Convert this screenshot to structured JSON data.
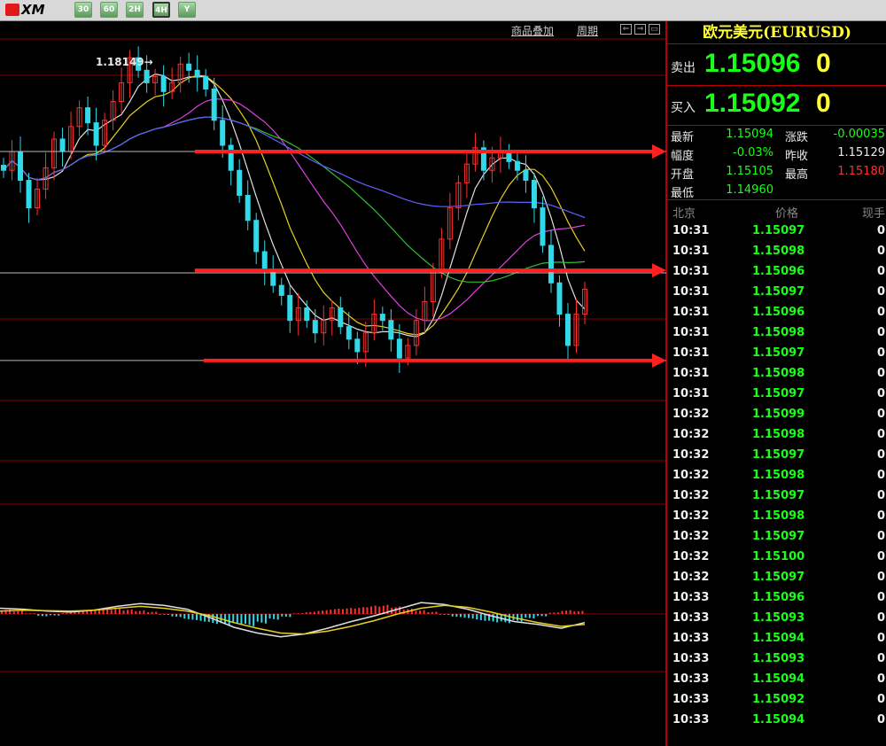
{
  "toolbar": {
    "logo_text": "XM",
    "buttons": [
      {
        "label": "30",
        "icon": "30-min-period"
      },
      {
        "label": "60",
        "icon": "60-min-period"
      },
      {
        "label": "2H",
        "icon": "2-hour-period"
      },
      {
        "label": "4H",
        "icon": "4-hour-period",
        "active": true
      },
      {
        "label": "Y",
        "icon": "filter-icon"
      }
    ]
  },
  "chart_header": {
    "add_product": "商品叠加",
    "period": "周期"
  },
  "chart_data": {
    "type": "candlestick",
    "symbol": "EURUSD",
    "timeframe": "4H",
    "annotation_high": "1.18149→",
    "price_range": [
      1.1485,
      1.1825
    ],
    "horizontal_levels_drawn": [
      1.1735,
      1.1638,
      1.1568
    ],
    "drawn_arrow_levels": [
      1.1735,
      1.164,
      1.1568
    ],
    "closes": [
      1.172,
      1.1735,
      1.1712,
      1.169,
      1.1705,
      1.1722,
      1.1745,
      1.1735,
      1.1755,
      1.177,
      1.1758,
      1.174,
      1.176,
      1.1775,
      1.179,
      1.181,
      1.18,
      1.179,
      1.1795,
      1.1783,
      1.179,
      1.1805,
      1.18,
      1.1795,
      1.1785,
      1.176,
      1.174,
      1.172,
      1.17,
      1.168,
      1.1655,
      1.164,
      1.1628,
      1.162,
      1.16,
      1.161,
      1.16,
      1.159,
      1.16,
      1.161,
      1.1595,
      1.1585,
      1.1575,
      1.159,
      1.1605,
      1.16,
      1.1585,
      1.157,
      1.158,
      1.16,
      1.1615,
      1.164,
      1.1665,
      1.169,
      1.171,
      1.1725,
      1.1738,
      1.172,
      1.173,
      1.1735,
      1.1727,
      1.172,
      1.1712,
      1.169,
      1.166,
      1.163,
      1.1605,
      1.158,
      1.1605,
      1.1625
    ],
    "macd_hist": [
      0.0012,
      0.0008,
      0.0002,
      -0.0006,
      -0.0004,
      0.0003,
      0.0009,
      0.0011,
      0.0012,
      0.0014,
      0.0012,
      0.0009,
      0.0006,
      -0.0002,
      -0.0008,
      -0.0015,
      -0.002,
      -0.0026,
      -0.003,
      -0.0028,
      -0.0032,
      -0.0025,
      -0.0015,
      -0.0008,
      0.0002,
      0.0006,
      0.001,
      0.0014,
      0.0016,
      0.0018,
      0.0022,
      0.0024,
      0.002,
      0.0014,
      0.001,
      0.0006,
      -0.0002,
      -0.0008,
      -0.0012,
      -0.0018,
      -0.0022,
      -0.0024,
      -0.002,
      -0.0012,
      -0.0006,
      0.0004,
      0.001,
      0.0008
    ],
    "macd_dif": [
      0.0012,
      0.001,
      0.0006,
      0.0004,
      0.0008,
      0.0016,
      0.0022,
      0.0018,
      0.001,
      -0.0008,
      -0.0028,
      -0.004,
      -0.0048,
      -0.0042,
      -0.003,
      -0.0016,
      -0.0004,
      0.001,
      0.0024,
      0.002,
      0.001,
      -0.0004,
      -0.0016,
      -0.0022,
      -0.003,
      -0.0018
    ],
    "macd_dea": [
      0.0006,
      0.0008,
      0.0007,
      0.0006,
      0.0008,
      0.0012,
      0.0016,
      0.0012,
      0.0006,
      -0.0004,
      -0.0018,
      -0.003,
      -0.004,
      -0.0042,
      -0.0036,
      -0.0026,
      -0.0014,
      0.0,
      0.0012,
      0.0018,
      0.0014,
      0.0004,
      -0.0008,
      -0.0018,
      -0.0026,
      -0.0022
    ],
    "colors": {
      "up": "#ff3030",
      "down": "#30d8e8",
      "ma5": "#e0e0e0",
      "ma10": "#e8d020",
      "ma20": "#e040e0",
      "ma30": "#30c030",
      "ma60": "#6060ff",
      "arrow": "#ff2020"
    }
  },
  "panel": {
    "title": "欧元美元(EURUSD)",
    "sell_label": "卖出",
    "sell_price": "1.15096",
    "sell_digit": "0",
    "buy_label": "买入",
    "buy_price": "1.15092",
    "buy_digit": "0",
    "stats": [
      {
        "l1": "最新",
        "v1": "1.15094",
        "c1": "green",
        "l2": "涨跌",
        "v2": "-0.00035",
        "c2": "green"
      },
      {
        "l1": "幅度",
        "v1": "-0.03%",
        "c1": "green",
        "l2": "昨收",
        "v2": "1.15129",
        "c2": "white"
      },
      {
        "l1": "开盘",
        "v1": "1.15105",
        "c1": "green",
        "l2": "最高",
        "v2": "1.15180",
        "c2": "red"
      },
      {
        "l1": "最低",
        "v1": "1.14960",
        "c1": "green",
        "l2": "",
        "v2": "",
        "c2": "white"
      }
    ],
    "ticks_header": {
      "time": "北京",
      "price": "价格",
      "vol": "现手"
    },
    "ticks": [
      {
        "time": "10:31",
        "price": "1.15097",
        "vol": "0"
      },
      {
        "time": "10:31",
        "price": "1.15098",
        "vol": "0"
      },
      {
        "time": "10:31",
        "price": "1.15096",
        "vol": "0"
      },
      {
        "time": "10:31",
        "price": "1.15097",
        "vol": "0"
      },
      {
        "time": "10:31",
        "price": "1.15096",
        "vol": "0"
      },
      {
        "time": "10:31",
        "price": "1.15098",
        "vol": "0"
      },
      {
        "time": "10:31",
        "price": "1.15097",
        "vol": "0"
      },
      {
        "time": "10:31",
        "price": "1.15098",
        "vol": "0"
      },
      {
        "time": "10:31",
        "price": "1.15097",
        "vol": "0"
      },
      {
        "time": "10:32",
        "price": "1.15099",
        "vol": "0"
      },
      {
        "time": "10:32",
        "price": "1.15098",
        "vol": "0"
      },
      {
        "time": "10:32",
        "price": "1.15097",
        "vol": "0"
      },
      {
        "time": "10:32",
        "price": "1.15098",
        "vol": "0"
      },
      {
        "time": "10:32",
        "price": "1.15097",
        "vol": "0"
      },
      {
        "time": "10:32",
        "price": "1.15098",
        "vol": "0"
      },
      {
        "time": "10:32",
        "price": "1.15097",
        "vol": "0"
      },
      {
        "time": "10:32",
        "price": "1.15100",
        "vol": "0"
      },
      {
        "time": "10:32",
        "price": "1.15097",
        "vol": "0"
      },
      {
        "time": "10:33",
        "price": "1.15096",
        "vol": "0"
      },
      {
        "time": "10:33",
        "price": "1.15093",
        "vol": "0"
      },
      {
        "time": "10:33",
        "price": "1.15094",
        "vol": "0"
      },
      {
        "time": "10:33",
        "price": "1.15093",
        "vol": "0"
      },
      {
        "time": "10:33",
        "price": "1.15094",
        "vol": "0"
      },
      {
        "time": "10:33",
        "price": "1.15092",
        "vol": "0"
      },
      {
        "time": "10:33",
        "price": "1.15094",
        "vol": "0"
      }
    ]
  }
}
